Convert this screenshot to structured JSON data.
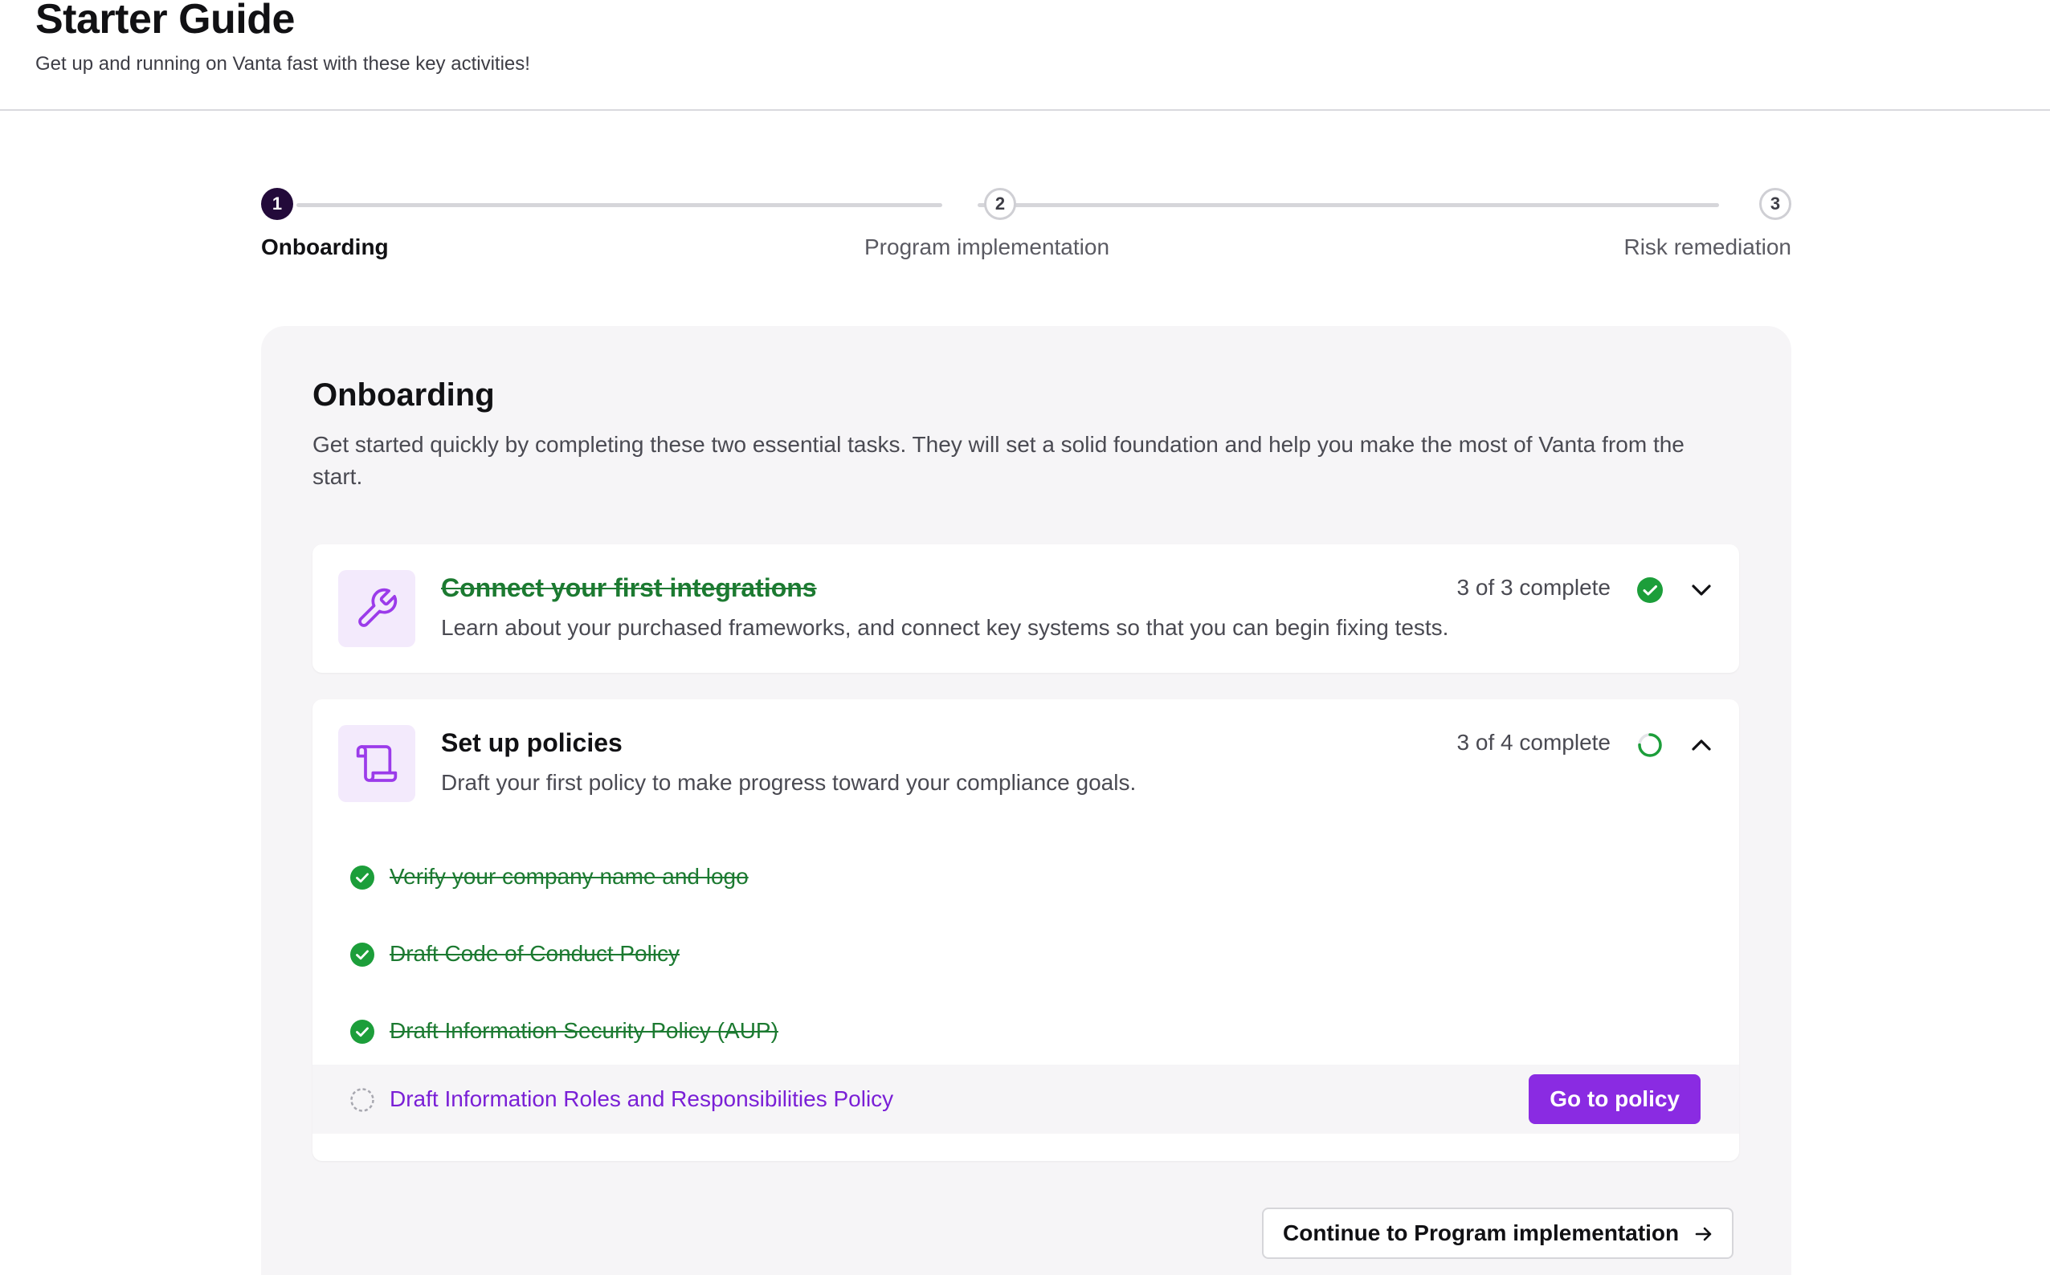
{
  "header": {
    "title": "Starter Guide",
    "subtitle": "Get up and running on Vanta fast with these key activities!"
  },
  "stepper": {
    "steps": [
      {
        "number": "1",
        "label": "Onboarding",
        "state": "active"
      },
      {
        "number": "2",
        "label": "Program implementation",
        "state": "todo"
      },
      {
        "number": "3",
        "label": "Risk remediation",
        "state": "todo"
      }
    ]
  },
  "panel": {
    "title": "Onboarding",
    "description": "Get started quickly by completing these two essential tasks. They will set a solid foundation and help you make the most of Vanta from the start.",
    "tasks": [
      {
        "icon": "wrench-icon",
        "title": "Connect your first integrations",
        "description": "Learn about your purchased frameworks, and connect key systems so that you can begin fixing tests.",
        "progress_text": "3 of 3 complete",
        "completed_count": 3,
        "total_count": 3,
        "status": "complete",
        "expanded": false
      },
      {
        "icon": "scroll-icon",
        "title": "Set up policies",
        "description": "Draft your first policy to make progress toward your compliance goals.",
        "progress_text": "3 of 4 complete",
        "completed_count": 3,
        "total_count": 4,
        "status": "in-progress",
        "expanded": true,
        "subtasks": [
          {
            "label": "Verify your company name and logo",
            "done": true
          },
          {
            "label": "Draft Code of Conduct Policy",
            "done": true
          },
          {
            "label": "Draft Information Security Policy (AUP)",
            "done": true
          },
          {
            "label": "Draft Information Roles and Responsibilities Policy",
            "done": false,
            "action_label": "Go to policy"
          }
        ]
      }
    ],
    "continue_label": "Continue to Program implementation"
  },
  "colors": {
    "accent": "#8a2be2",
    "link": "#7a1fd6",
    "success": "#1c9e3a",
    "active_step": "#230a3a",
    "panel_bg": "#f6f5f7"
  }
}
